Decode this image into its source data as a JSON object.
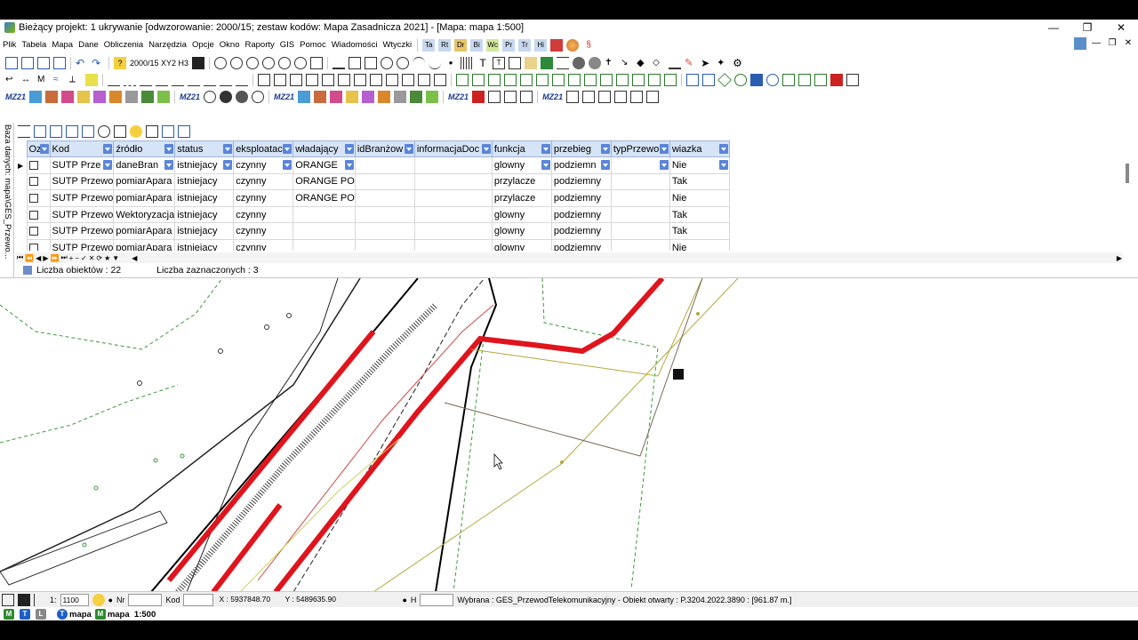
{
  "window": {
    "title": "Bieżący projekt: 1 ukrywanie [odwzorowanie: 2000/15; zestaw kodów: Mapa Zasadnicza 2021] - [Mapa: mapa  1:500]"
  },
  "menu": [
    "Plik",
    "Tabela",
    "Mapa",
    "Dane",
    "Obliczenia",
    "Narzędzia",
    "Opcje",
    "Okno",
    "Raporty",
    "GIS",
    "Pomoc",
    "Wiadomości",
    "Wtyczki"
  ],
  "toolbar": {
    "coord_system": "2000/15 XY2 H3",
    "mz_label": "MZ21"
  },
  "db_panel": {
    "label": "Baza danych: mapa\\GES_Przewo..."
  },
  "grid": {
    "columns": [
      "Oz",
      "Kod",
      "źródło",
      "status",
      "eksploatac",
      "władający",
      "idBranżow",
      "informacjaDoc",
      "funkcja",
      "przebieg",
      "typPrzewo",
      "wiazka"
    ],
    "rows": [
      {
        "kod": "SUTP Prze",
        "zrodlo": "daneBran",
        "status": "istniejacy",
        "eksploatacja": "czynny",
        "wladajacy": "ORANGE",
        "idBranzowy": "",
        "informacja": "",
        "funkcja": "glowny",
        "przebieg": "podziemn",
        "typ": "",
        "wiazka": "Nie"
      },
      {
        "kod": "SUTP Przewo",
        "zrodlo": "pomiarApara",
        "status": "istniejacy",
        "eksploatacja": "czynny",
        "wladajacy": "ORANGE PO",
        "idBranzowy": "",
        "informacja": "",
        "funkcja": "przylacze",
        "przebieg": "podziemny",
        "typ": "",
        "wiazka": "Tak"
      },
      {
        "kod": "SUTP Przewo",
        "zrodlo": "pomiarApara",
        "status": "istniejacy",
        "eksploatacja": "czynny",
        "wladajacy": "ORANGE PO",
        "idBranzowy": "",
        "informacja": "",
        "funkcja": "przylacze",
        "przebieg": "podziemny",
        "typ": "",
        "wiazka": "Nie"
      },
      {
        "kod": "SUTP Przewo",
        "zrodlo": "Wektoryzacja",
        "status": "istniejacy",
        "eksploatacja": "czynny",
        "wladajacy": "",
        "idBranzowy": "",
        "informacja": "",
        "funkcja": "glowny",
        "przebieg": "podziemny",
        "typ": "",
        "wiazka": "Tak"
      },
      {
        "kod": "SUTP Przewo",
        "zrodlo": "pomiarApara",
        "status": "istniejacy",
        "eksploatacja": "czynny",
        "wladajacy": "",
        "idBranzowy": "",
        "informacja": "",
        "funkcja": "glowny",
        "przebieg": "podziemny",
        "typ": "",
        "wiazka": "Tak"
      },
      {
        "kod": "SUTP Przewo",
        "zrodlo": "pomiarApara",
        "status": "istniejacy",
        "eksploatacja": "czynny",
        "wladajacy": "",
        "idBranzowy": "",
        "informacja": "",
        "funkcja": "glowny",
        "przebieg": "podziemny",
        "typ": "",
        "wiazka": "Nie"
      }
    ]
  },
  "counts": {
    "objects": "Liczba obiektów : 22",
    "selected": "Liczba zaznaczonych : 3"
  },
  "statusbar": {
    "scale_prefix": "1:",
    "scale_value": "1100",
    "nr_label": "Nr",
    "kod_label": "Kod",
    "x_coord": "X : 5937848.70",
    "y_coord": "Y : 5489635.90",
    "h_label": "H",
    "selected_info": "Wybrana : GES_PrzewodTelekomunikacyjny   -   Obiekt otwarty : P.3204.2022.3890 : [961.87 m.]"
  },
  "tabs": [
    {
      "icon": "T",
      "label": "mapa"
    },
    {
      "icon": "M",
      "label": "mapa  1:500"
    }
  ],
  "colors": {
    "grid_header": "#d6e4f7",
    "cable_red": "#e0141c",
    "tab_t": "#1f5fc4",
    "tab_m": "#2e8b2e"
  }
}
